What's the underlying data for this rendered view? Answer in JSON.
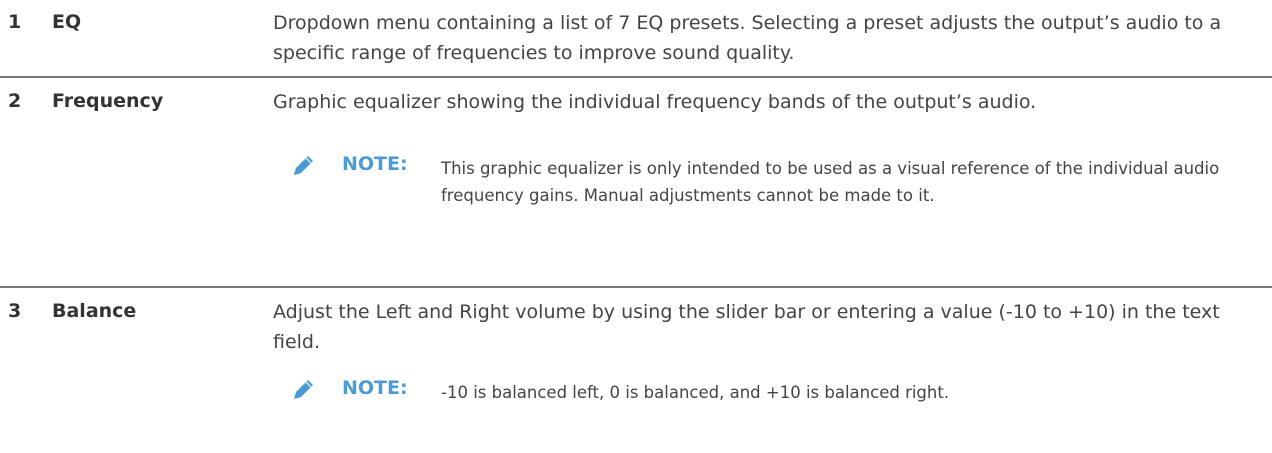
{
  "rows": [
    {
      "number": "1",
      "name": "EQ",
      "description": "Dropdown menu containing a list of 7 EQ presets. Selecting a preset adjusts the output’s audio to a specific range of frequencies to improve sound quality."
    },
    {
      "number": "2",
      "name": "Frequency",
      "description": "Graphic equalizer showing the individual frequency bands of the output’s audio.",
      "note": {
        "icon": "pencil-icon",
        "label": "NOTE:",
        "text": "This graphic equalizer is only intended to be used as a visual reference of the individual audio frequency gains. Manual adjustments cannot be made to it."
      }
    },
    {
      "number": "3",
      "name": "Balance",
      "description": "Adjust the Left and Right volume by using the slider bar or entering a value (-10 to +10) in the text field.",
      "note": {
        "icon": "pencil-icon",
        "label": "NOTE:",
        "text": "-10 is balanced left, 0 is balanced, and +10 is balanced right."
      }
    }
  ],
  "colors": {
    "note_accent": "#4a9ad6",
    "divider": "#7a7a7a",
    "body_text": "#444444"
  }
}
